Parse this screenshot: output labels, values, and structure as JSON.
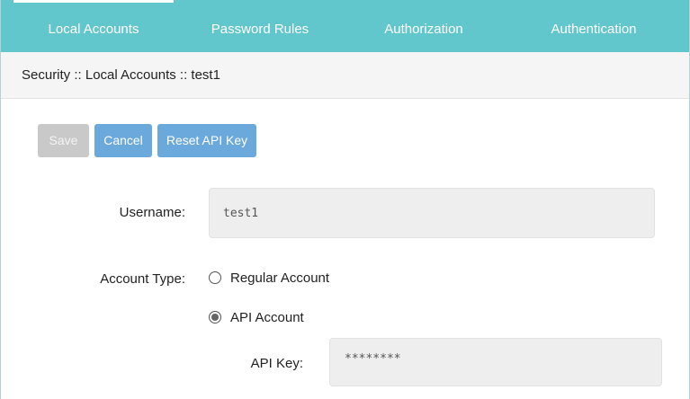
{
  "tabs": [
    {
      "label": "Local Accounts",
      "active": true
    },
    {
      "label": "Password Rules",
      "active": false
    },
    {
      "label": "Authorization",
      "active": false
    },
    {
      "label": "Authentication",
      "active": false
    }
  ],
  "breadcrumb": "Security :: Local Accounts :: test1",
  "toolbar": {
    "save_label": "Save",
    "cancel_label": "Cancel",
    "reset_api_key_label": "Reset API Key"
  },
  "form": {
    "username_label": "Username:",
    "username_value": "test1",
    "account_type_label": "Account Type:",
    "account_type_options": [
      {
        "label": "Regular Account",
        "checked": false
      },
      {
        "label": "API Account",
        "checked": true
      }
    ],
    "api_key_label": "API Key:",
    "api_key_value": "********"
  },
  "colors": {
    "tab_bar": "#62c6cd",
    "primary_button": "#6ba9dc",
    "disabled_button": "#c9c9c9"
  }
}
